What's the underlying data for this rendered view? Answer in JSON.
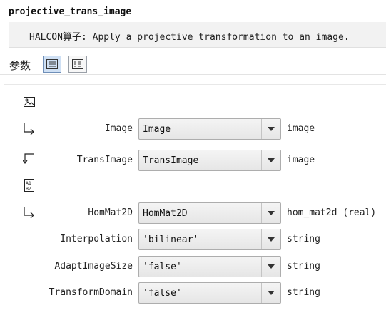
{
  "operator": {
    "name": "projective_trans_image",
    "description": "HALCON算子: Apply a projective transformation to an image."
  },
  "toolbar": {
    "label": "参数"
  },
  "params": [
    {
      "name": "Image",
      "value": "Image",
      "type": "image",
      "direction": "input"
    },
    {
      "name": "TransImage",
      "value": "TransImage",
      "type": "image",
      "direction": "output"
    },
    {
      "name": "HomMat2D",
      "value": "HomMat2D",
      "type": "hom_mat2d (real)",
      "direction": "input"
    },
    {
      "name": "Interpolation",
      "value": "'bilinear'",
      "type": "string",
      "direction": "control"
    },
    {
      "name": "AdaptImageSize",
      "value": "'false'",
      "type": "string",
      "direction": "control"
    },
    {
      "name": "TransformDomain",
      "value": "'false'",
      "type": "string",
      "direction": "control"
    }
  ],
  "icons": {
    "iconic_section": "image-section-icon",
    "control_section": "control-section-icon",
    "input": "input-arrow-icon",
    "output": "output-arrow-icon",
    "dropdown": "chevron-down-icon"
  },
  "colors": {
    "active_button": "#cfe0f4",
    "description_bg": "#f2f2f2",
    "combo_bg": "#e6e6e6"
  }
}
